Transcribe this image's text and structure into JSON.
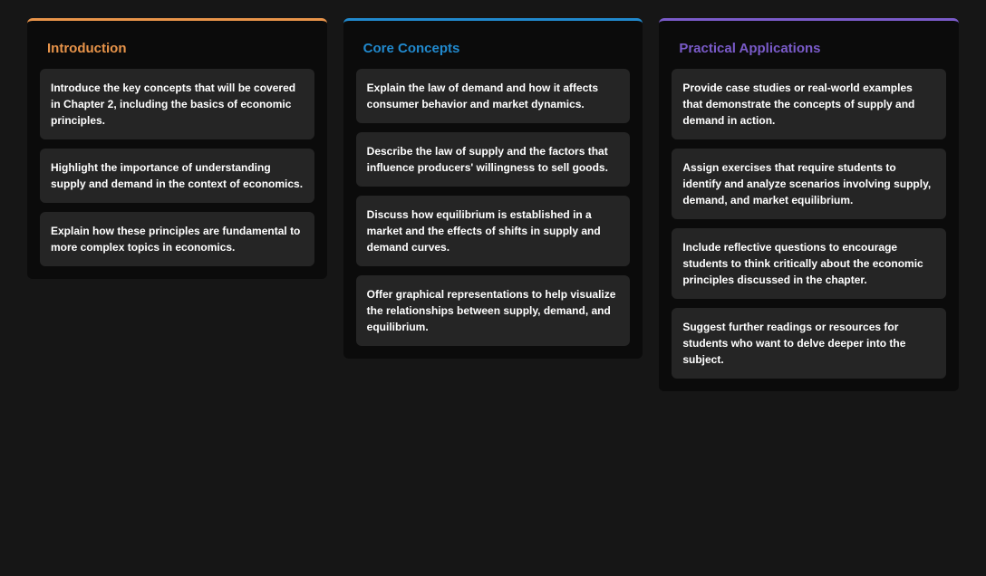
{
  "columns": [
    {
      "title": "Introduction",
      "colorClass": "orange",
      "cards": [
        "Introduce the key concepts that will be covered in Chapter 2, including the basics of economic principles.",
        "Highlight the importance of understanding supply and demand in the context of economics.",
        "Explain how these principles are fundamental to more complex topics in economics."
      ]
    },
    {
      "title": "Core Concepts",
      "colorClass": "blue",
      "cards": [
        "Explain the law of demand and how it affects consumer behavior and market dynamics.",
        "Describe the law of supply and the factors that influence producers' willingness to sell goods.",
        "Discuss how equilibrium is established in a market and the effects of shifts in supply and demand curves.",
        "Offer graphical representations to help visualize the relationships between supply, demand, and equilibrium."
      ]
    },
    {
      "title": "Practical Applications",
      "colorClass": "purple",
      "cards": [
        "Provide case studies or real-world examples that demonstrate the concepts of supply and demand in action.",
        "Assign exercises that require students to identify and analyze scenarios involving supply, demand, and market equilibrium.",
        "Include reflective questions to encourage students to think critically about the economic principles discussed in the chapter.",
        "Suggest further readings or resources for students who want to delve deeper into the subject."
      ]
    }
  ]
}
